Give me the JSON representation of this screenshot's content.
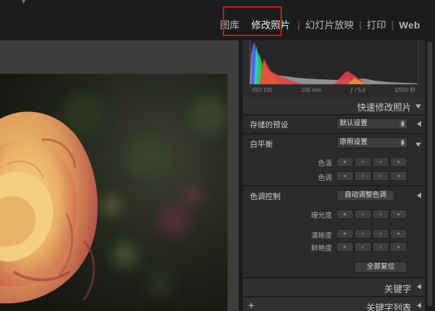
{
  "modules": {
    "library": "图库",
    "develop": "修改照片",
    "slideshow": "幻灯片放映",
    "print": "打印",
    "web": "Web"
  },
  "histogram": {
    "iso": "ISO 100",
    "focal": "105 mm",
    "aperture": "ƒ / 5.6",
    "shutter": "1/500 秒"
  },
  "quick_develop": {
    "title": "快速修改照片",
    "saved_preset_label": "存储的预设",
    "saved_preset_value": "默认设置",
    "white_balance_label": "白平衡",
    "white_balance_value": "原照设置",
    "temp_label": "色温",
    "tint_label": "色调",
    "tone_control_label": "色调控制",
    "auto_tone_button": "自动调整色调",
    "exposure_label": "曝光度",
    "clarity_label": "清晰度",
    "vibrance_label": "鲜艳度",
    "reset_all_button": "全部复位"
  },
  "stepper_glyphs": {
    "dbl_left": "« ",
    "left": "‹",
    "right": "›",
    "dbl_right": "»"
  },
  "keywording": {
    "title": "关键字"
  },
  "keyword_list": {
    "title": "关键字列表",
    "add": "+"
  },
  "colors": {
    "highlight": "#e01010",
    "panel": "#2b2b2b",
    "topbar": "#1c1c1c"
  }
}
